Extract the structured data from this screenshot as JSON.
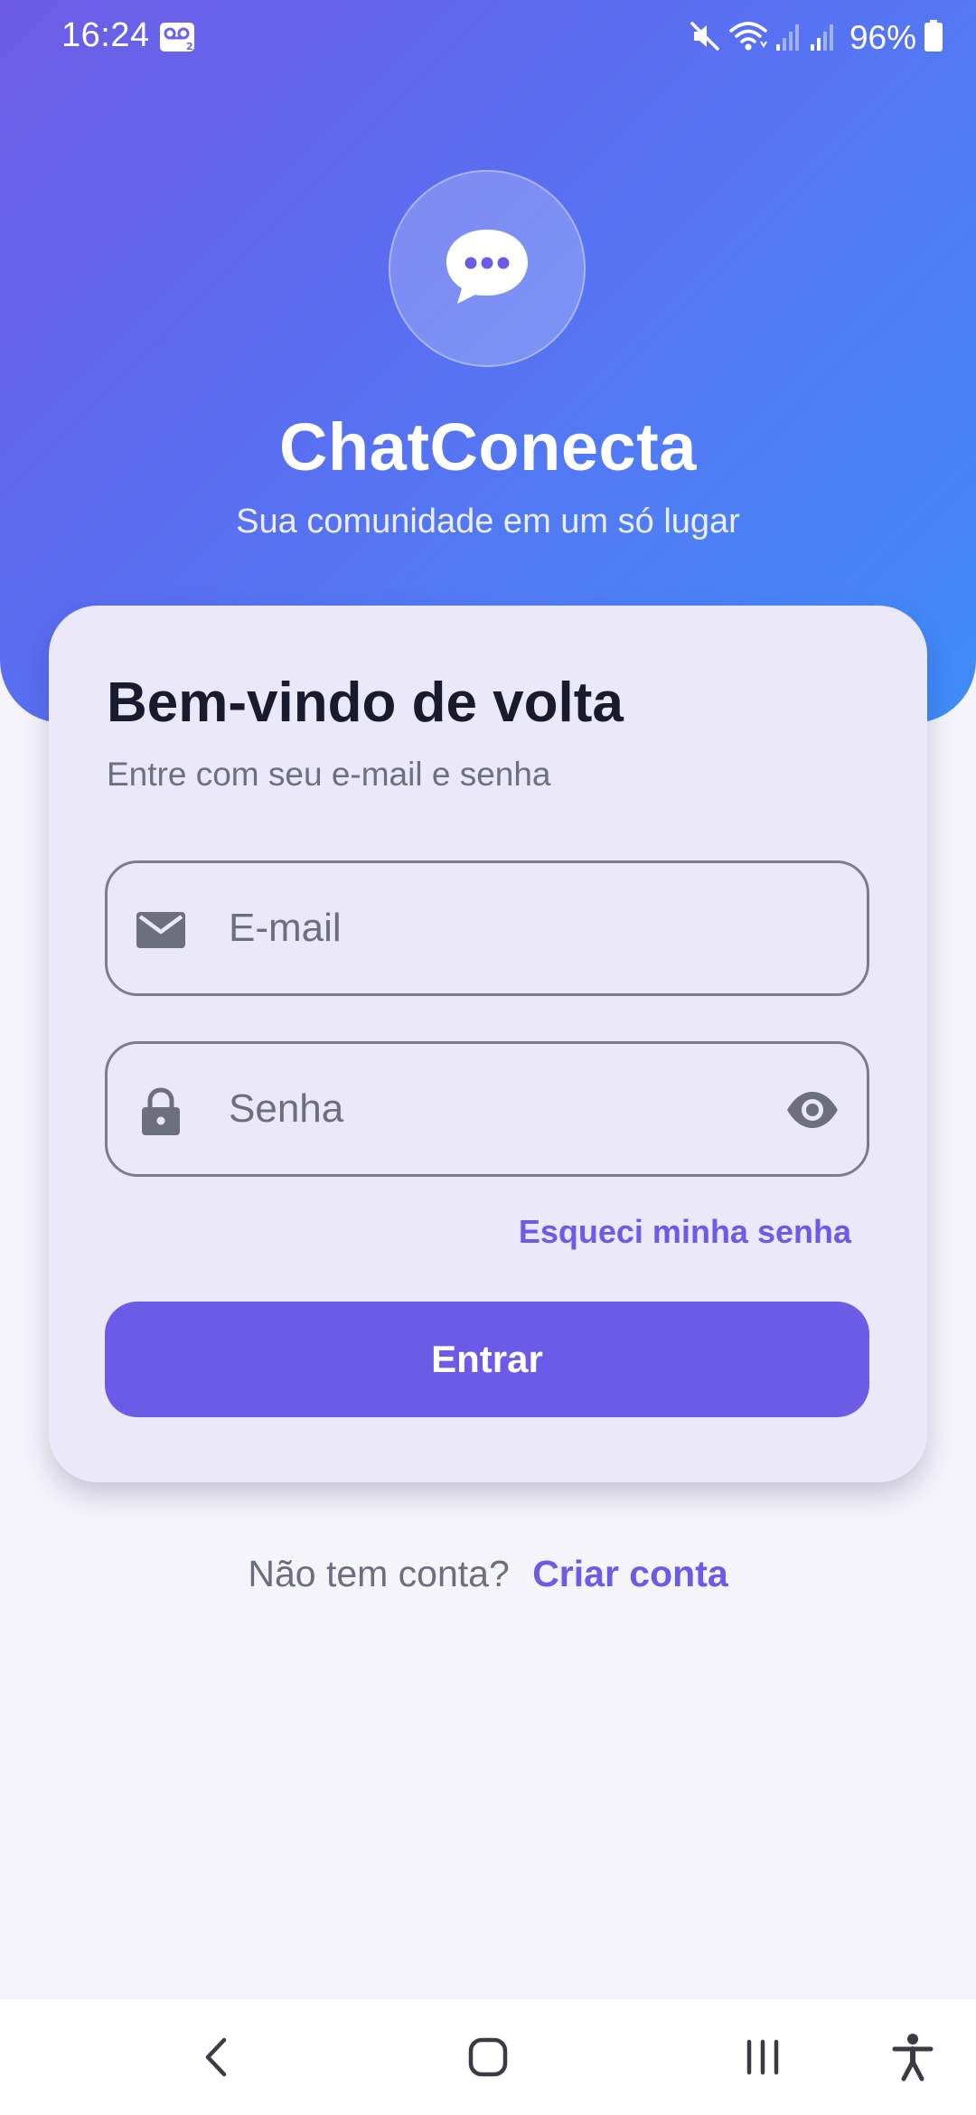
{
  "status_bar": {
    "time": "16:24",
    "battery_percent": "96%",
    "icons": [
      "voicemail-icon",
      "mute-icon",
      "wifi-icon",
      "signal-icon",
      "signal-icon",
      "battery-icon"
    ]
  },
  "header": {
    "app_name": "ChatConecta",
    "tagline": "Sua comunidade em um só lugar",
    "logo_icon": "chat-bubble-icon"
  },
  "login_card": {
    "title": "Bem-vindo de volta",
    "subtitle": "Entre com seu e-mail e senha",
    "email_field": {
      "placeholder": "E-mail",
      "value": "",
      "icon": "mail-icon"
    },
    "password_field": {
      "placeholder": "Senha",
      "value": "",
      "icon": "lock-icon",
      "toggle_icon": "eye-icon"
    },
    "forgot_password": "Esqueci minha senha",
    "submit_label": "Entrar"
  },
  "signup": {
    "prompt": "Não tem conta?",
    "link": "Criar conta"
  },
  "nav_bar": {
    "buttons": [
      "back-icon",
      "home-icon",
      "recents-icon",
      "accessibility-icon"
    ]
  },
  "colors": {
    "accent": "#6b5be6",
    "gradient_start": "#6e5ce6",
    "gradient_end": "#3f8cf9",
    "card_background": "#ebe8fa",
    "page_background": "#f4f4fa"
  }
}
